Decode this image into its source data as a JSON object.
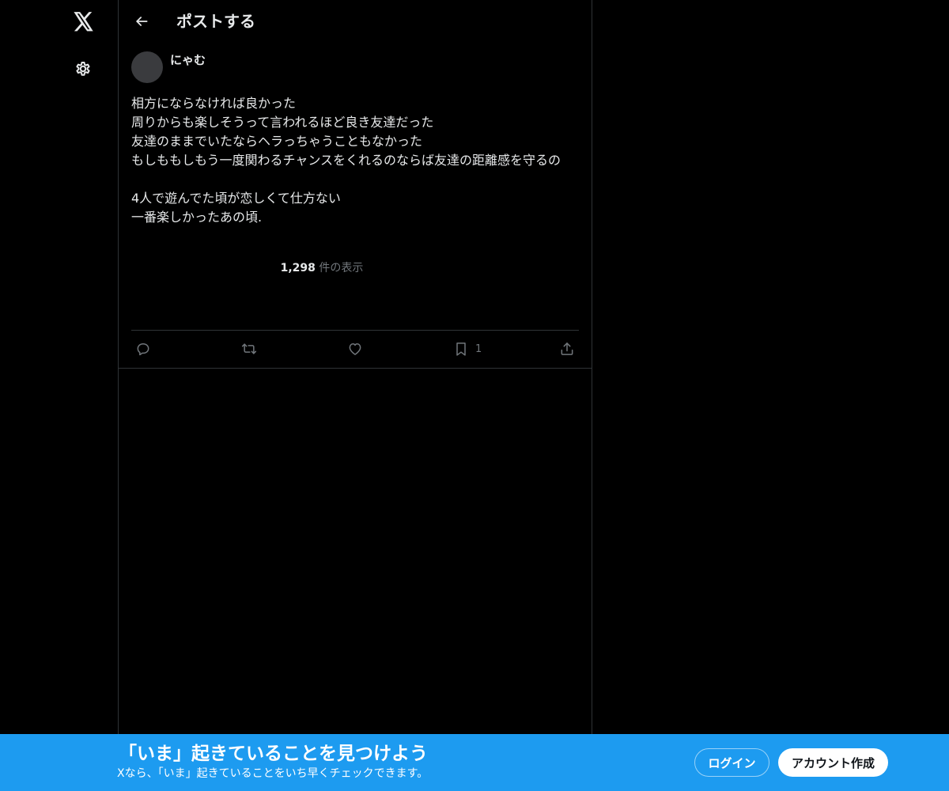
{
  "nav": {
    "logo_icon": "x-logo-icon",
    "settings_icon": "gear-icon"
  },
  "header": {
    "back_icon": "arrow-left-icon",
    "title": "ポストする"
  },
  "post": {
    "author_name": "にゃむ",
    "lines": [
      "相方にならなければ良かった",
      "周りからも楽しそうって言われるほど良き友達だった",
      "友達のままでいたならヘラっちゃうこともなかった",
      "もしももしもう一度関わるチャンスをくれるのならば友達の距離感を守るの",
      "",
      "4人で遊んでた頃が恋しくて仕方ない",
      "一番楽しかったあの頃."
    ],
    "views_count": "1,298",
    "views_label": " 件の表示"
  },
  "actions": {
    "reply_icon": "reply-icon",
    "repost_icon": "repost-icon",
    "like_icon": "heart-icon",
    "bookmark_icon": "bookmark-icon",
    "bookmark_count": "1",
    "share_icon": "share-icon"
  },
  "bottom_bar": {
    "title": "「いま」起きていることを見つけよう",
    "subtitle": "Xなら、「いま」起きていることをいち早くチェックできます。",
    "login_label": "ログイン",
    "signup_label": "アカウント作成",
    "background_color": "#1d9bf0"
  }
}
